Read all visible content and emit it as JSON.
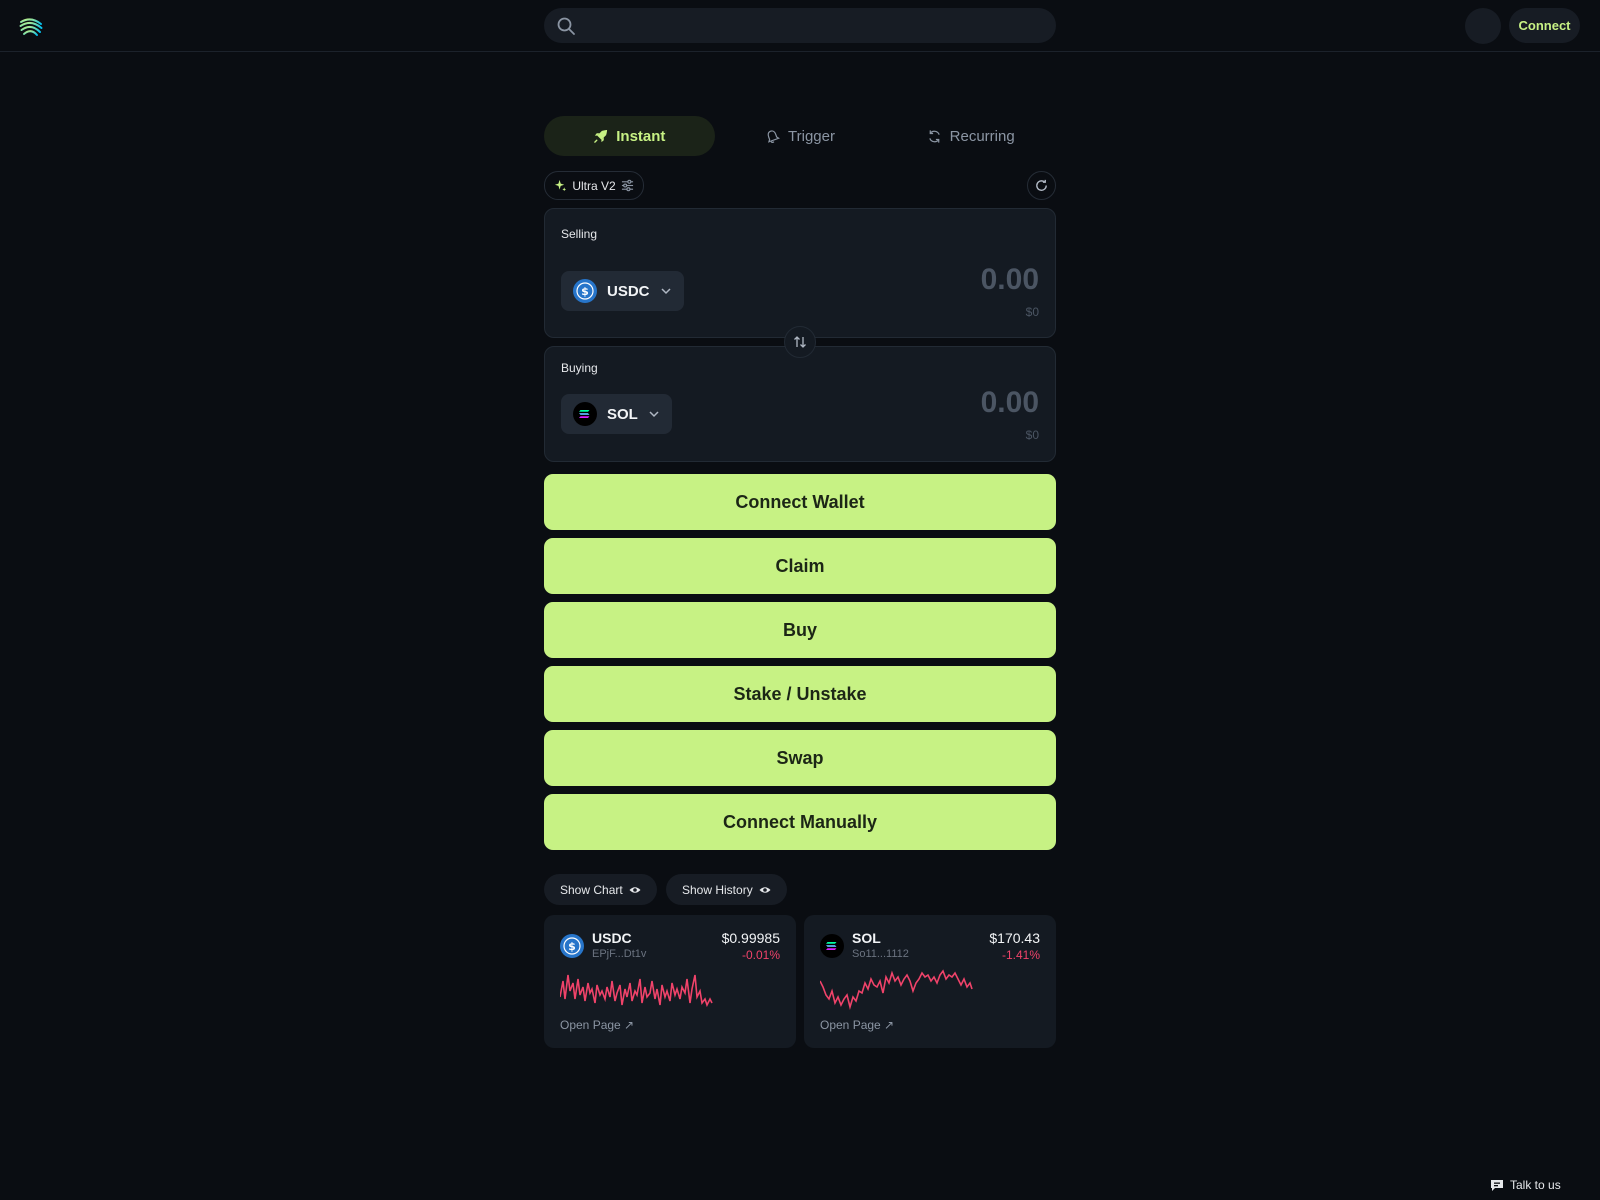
{
  "header": {
    "search_placeholder": "",
    "connect_label": "Connect"
  },
  "tabs": [
    {
      "label": "Instant",
      "icon": "rocket-icon",
      "active": true
    },
    {
      "label": "Trigger",
      "icon": "bell-icon",
      "active": false
    },
    {
      "label": "Recurring",
      "icon": "recurring-icon",
      "active": false
    }
  ],
  "mode": {
    "label": "Ultra V2"
  },
  "selling": {
    "label": "Selling",
    "token": "USDC",
    "amount": "0.00",
    "usd": "$0"
  },
  "buying": {
    "label": "Buying",
    "token": "SOL",
    "amount": "0.00",
    "usd": "$0"
  },
  "actions": [
    "Connect Wallet",
    "Claim",
    "Buy",
    "Stake / Unstake",
    "Swap",
    "Connect Manually"
  ],
  "toggles": {
    "show_chart": "Show Chart",
    "show_history": "Show History"
  },
  "cards": [
    {
      "symbol": "USDC",
      "address": "EPjF...Dt1v",
      "price": "$0.99985",
      "change": "-0.01%",
      "open_label": "Open Page ↗"
    },
    {
      "symbol": "SOL",
      "address": "So11...1112",
      "price": "$170.43",
      "change": "-1.41%",
      "open_label": "Open Page ↗"
    }
  ],
  "footer": {
    "talk_label": "Talk to us"
  },
  "colors": {
    "background": "#0a0d12",
    "accent": "#c7f284",
    "negative": "#f0436a",
    "usdc_blue": "#2775ca"
  }
}
